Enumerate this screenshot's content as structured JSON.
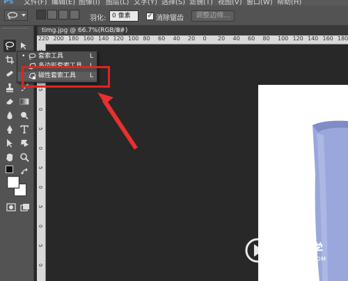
{
  "app": {
    "logo": "Ps"
  },
  "menu": {
    "items": [
      "文件(F)",
      "编辑(E)",
      "图像(I)",
      "图层(L)",
      "文字(Y)",
      "选择(S)",
      "滤镜(T)",
      "视图(V)",
      "窗口(W)",
      "帮助(H)"
    ]
  },
  "options": {
    "feather_label": "羽化:",
    "feather_value": "0 像素",
    "antialias_label": "消除锯齿",
    "antialias_checked": "✓",
    "refine_edge_label": "调整边缘..."
  },
  "document": {
    "tab_title": "timg.jpg @ 66.7%(RGB/8#)",
    "close_glyph": "×"
  },
  "ruler": {
    "top_numbers": [
      "220",
      "200",
      "180",
      "160",
      "140",
      "120",
      "100",
      "80",
      "60",
      "40",
      "20",
      "0",
      "20",
      "40",
      "60",
      "80",
      "100",
      "120",
      "140",
      "160",
      "180"
    ],
    "left_numbers": [
      "5",
      "0",
      "5",
      "0",
      "5",
      "0",
      "5",
      "0",
      "5",
      "0",
      "5",
      "0"
    ]
  },
  "flyout": {
    "items": [
      {
        "label": "套索工具",
        "shortcut": "L",
        "mark": "•"
      },
      {
        "label": "多边形套索工具",
        "shortcut": "L",
        "mark": ""
      },
      {
        "label": "磁性套索工具",
        "shortcut": "L",
        "mark": ""
      }
    ]
  },
  "watermark": {
    "title": "溜溜自学",
    "url": "ZIXUE.3D66.COM"
  },
  "colors": {
    "highlight": "#e02424",
    "arrow": "#e8302f",
    "cup": "#9aa7dc"
  },
  "icons": [
    "lasso-icon",
    "move-icon",
    "marquee-icon",
    "crop-icon",
    "eyedropper-icon",
    "healing-brush-icon",
    "brush-icon",
    "stamp-icon",
    "history-brush-icon",
    "eraser-icon",
    "gradient-icon",
    "blur-icon",
    "dodge-icon",
    "pen-icon",
    "type-icon",
    "path-select-icon",
    "shape-icon",
    "hand-icon",
    "zoom-icon",
    "swap-colors-icon",
    "quick-mask-icon",
    "screen-mode-icon"
  ]
}
